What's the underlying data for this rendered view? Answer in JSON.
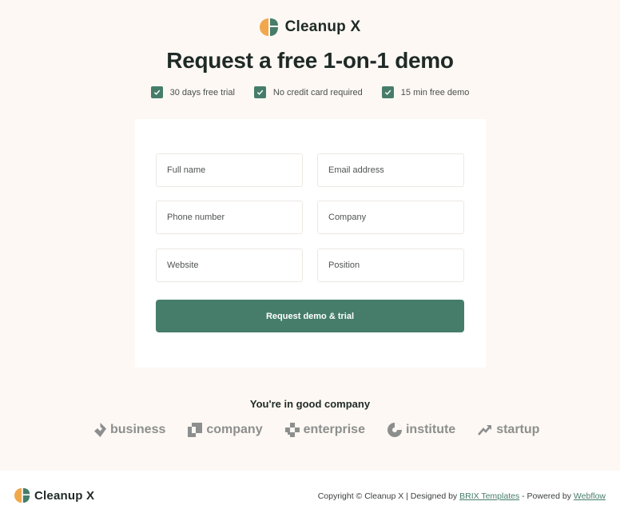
{
  "brand": {
    "name": "Cleanup X",
    "logo_icon": "leaf-logo-icon",
    "logo_colors": [
      "#f1a84c",
      "#467d6a"
    ]
  },
  "headline": "Request a free 1-on-1 demo",
  "perks": [
    {
      "label": "30 days free trial",
      "icon": "check-icon"
    },
    {
      "label": "No credit card required",
      "icon": "check-icon"
    },
    {
      "label": "15 min free demo",
      "icon": "check-icon"
    }
  ],
  "form": {
    "full_name_placeholder": "Full name",
    "email_placeholder": "Email address",
    "phone_placeholder": "Phone number",
    "company_placeholder": "Company",
    "website_placeholder": "Website",
    "position_placeholder": "Position",
    "submit_label": "Request demo & trial"
  },
  "social_proof": {
    "heading": "You're in good company",
    "clients": [
      {
        "name": "business",
        "icon": "business-logo-icon"
      },
      {
        "name": "company",
        "icon": "company-logo-icon"
      },
      {
        "name": "enterprise",
        "icon": "enterprise-logo-icon"
      },
      {
        "name": "institute",
        "icon": "institute-logo-icon"
      },
      {
        "name": "startup",
        "icon": "startup-logo-icon"
      }
    ]
  },
  "footer": {
    "brand": "Cleanup X",
    "copyright_prefix": "Copyright © Cleanup X | Designed by",
    "designer_link": "BRIX Templates",
    "powered_prefix": "- Powered by",
    "powered_link": "Webflow"
  },
  "colors": {
    "accent": "#467d6a",
    "background": "#fdf8f3",
    "logo_orange": "#f1a84c"
  }
}
